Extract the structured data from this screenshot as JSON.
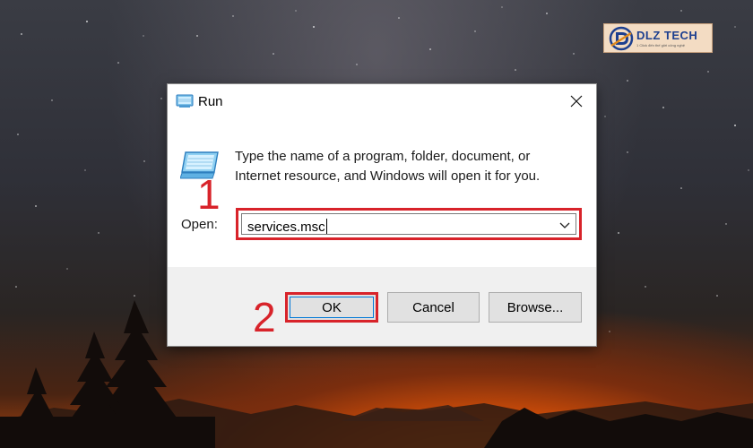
{
  "logo": {
    "name": "DLZ TECH",
    "slogan": "1 Click đến thế giới công nghệ"
  },
  "dialog": {
    "title": "Run",
    "description": "Type the name of a program, folder, document, or Internet resource, and Windows will open it for you.",
    "open_label": "Open:",
    "open_value": "services.msc",
    "buttons": {
      "ok": "OK",
      "cancel": "Cancel",
      "browse": "Browse..."
    }
  },
  "annotations": {
    "step1": "1",
    "step2": "2"
  },
  "colors": {
    "highlight": "#d8232a",
    "focus": "#0078d7",
    "dialog_footer": "#f0f0f0"
  },
  "icons": [
    "run-icon",
    "close-icon",
    "chevron-down-icon"
  ]
}
